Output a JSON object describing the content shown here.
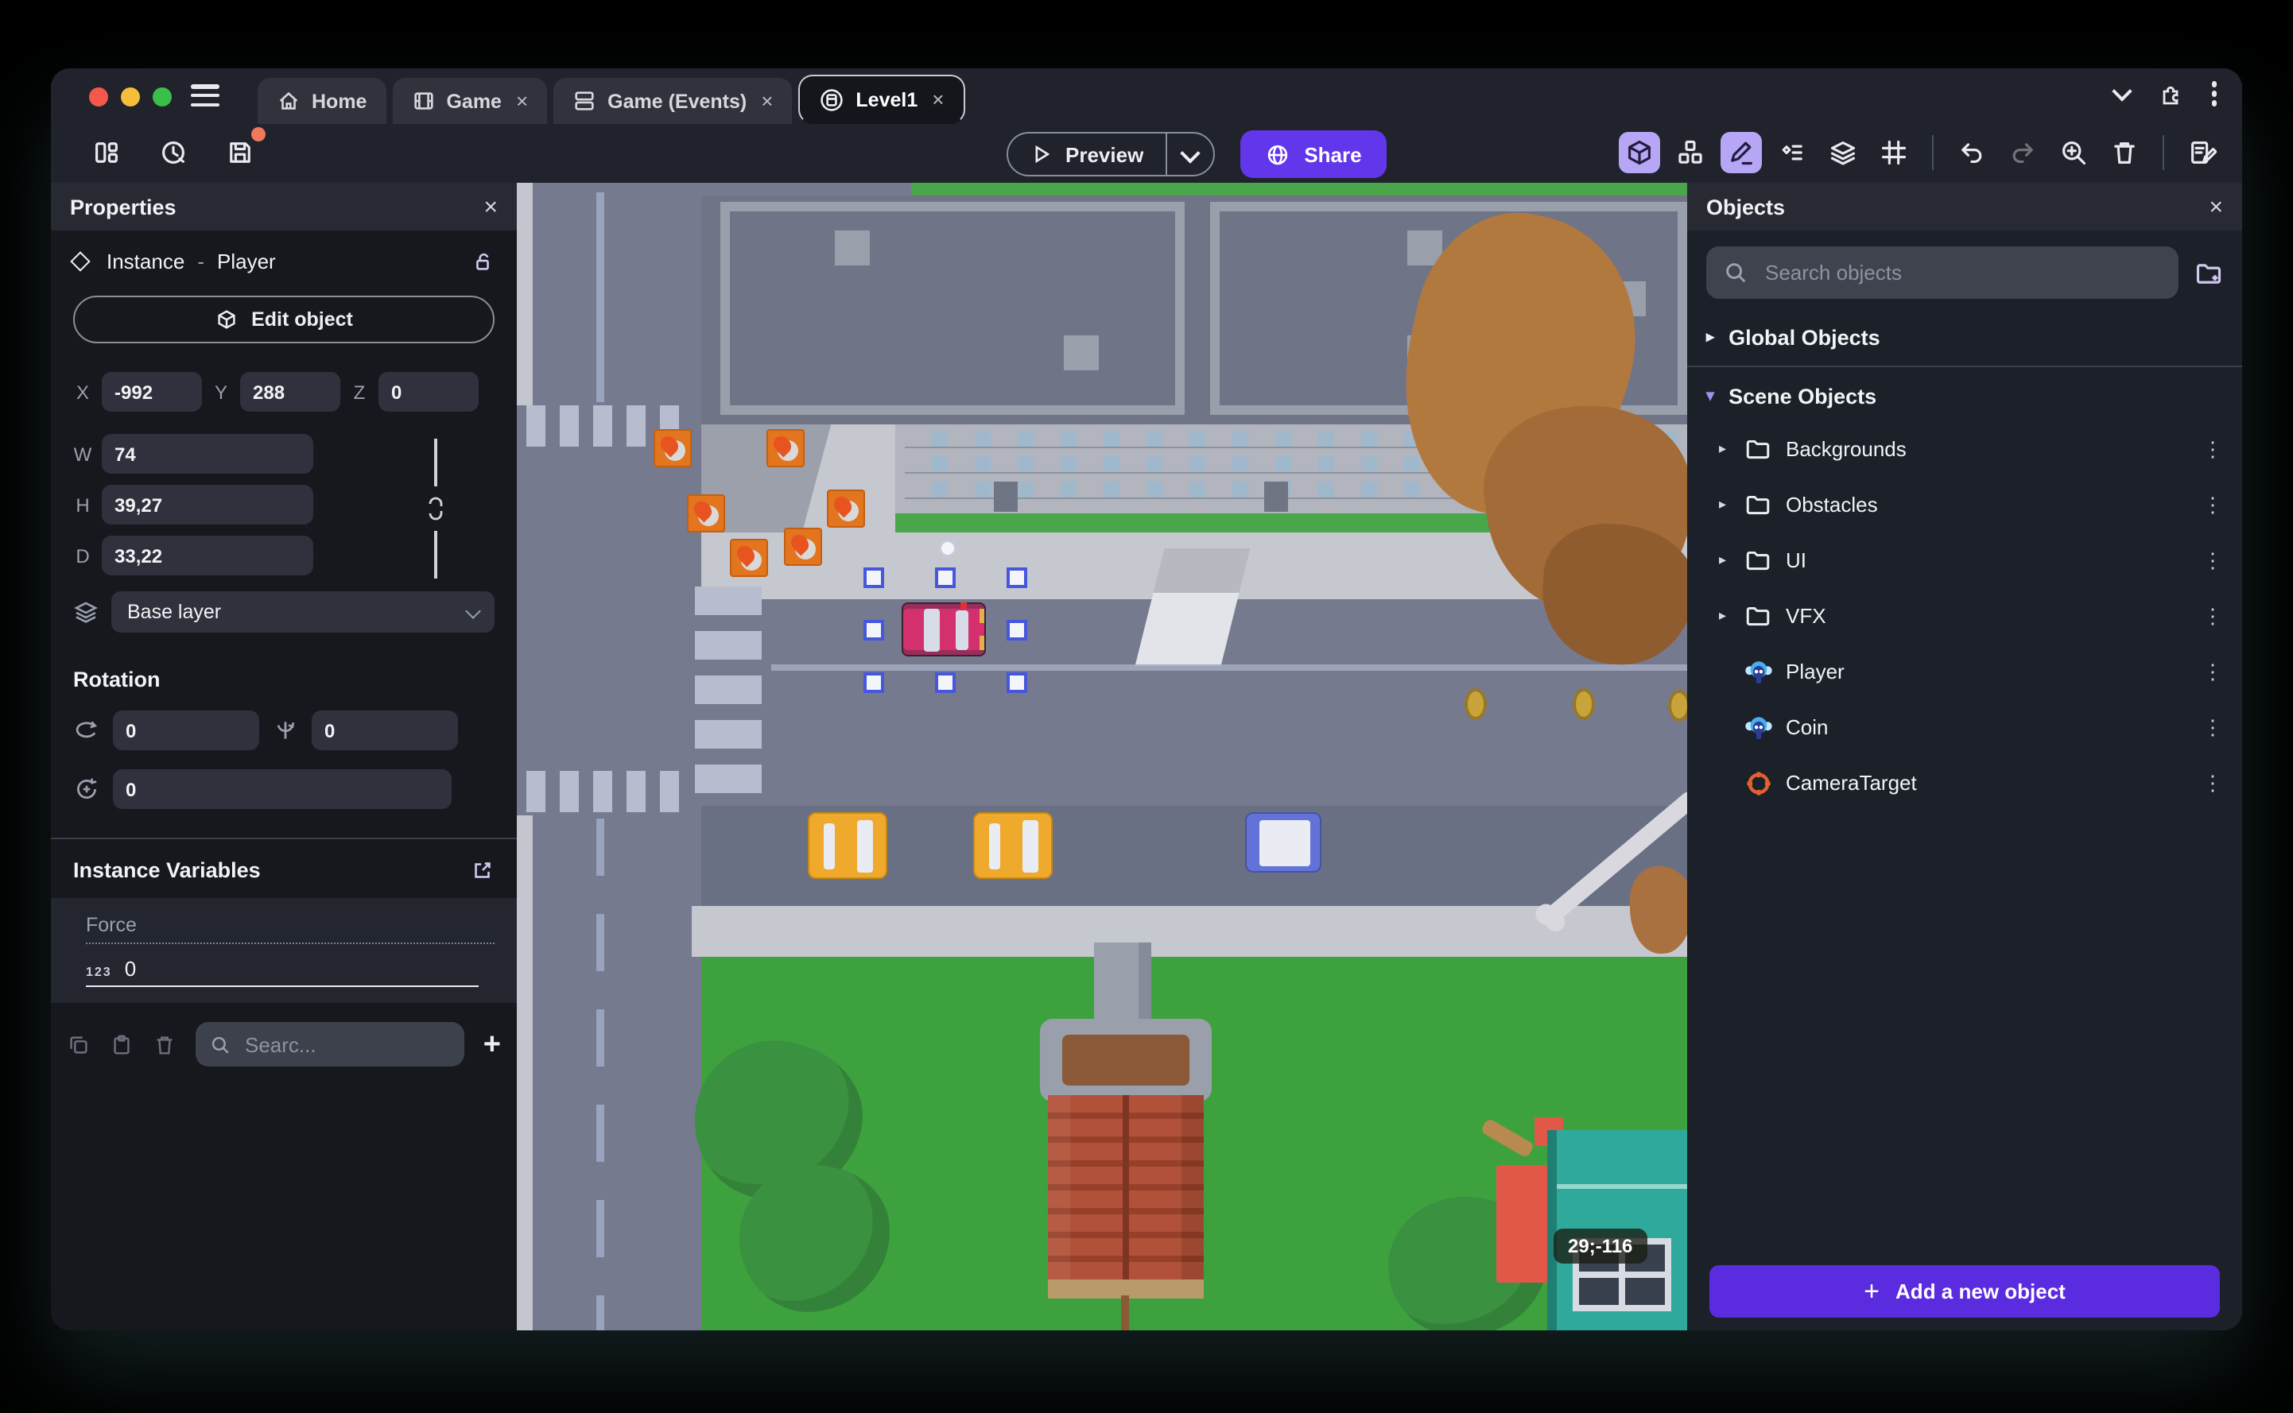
{
  "titlebar": {
    "tabs": [
      {
        "label": "Home"
      },
      {
        "label": "Game"
      },
      {
        "label": "Game (Events)"
      },
      {
        "label": "Level1"
      }
    ],
    "close_glyph": "×"
  },
  "toolbar": {
    "preview": "Preview",
    "share": "Share"
  },
  "properties": {
    "title": "Properties",
    "close_glyph": "×",
    "kind": "Instance",
    "dash": "-",
    "object_name": "Player",
    "edit_object": "Edit object",
    "x_label": "X",
    "x_value": "-992",
    "y_label": "Y",
    "y_value": "288",
    "z_label": "Z",
    "z_value": "0",
    "w_label": "W",
    "w_value": "74",
    "h_label": "H",
    "h_value": "39,27",
    "d_label": "D",
    "d_value": "33,22",
    "layer_value": "Base layer",
    "rotation_title": "Rotation",
    "rot_x": "0",
    "rot_y": "0",
    "rot_z": "0",
    "variables_title": "Instance Variables",
    "variable_name": "Force",
    "variable_type_badge": "123",
    "variable_value": "0",
    "variables_search_placeholder": "Searc...",
    "add_glyph": "+"
  },
  "objects": {
    "title": "Objects",
    "close_glyph": "×",
    "search_placeholder": "Search objects",
    "global_group": "Global Objects",
    "scene_group": "Scene Objects",
    "collapsed_glyph": "▸",
    "expanded_glyph": "▾",
    "menu_glyph": "⋮",
    "folders": [
      {
        "name": "Backgrounds"
      },
      {
        "name": "Obstacles"
      },
      {
        "name": "UI"
      },
      {
        "name": "VFX"
      }
    ],
    "items": [
      {
        "name": "Player",
        "icon": "monkey-icon"
      },
      {
        "name": "Coin",
        "icon": "monkey-icon"
      },
      {
        "name": "CameraTarget",
        "icon": "target-icon"
      }
    ],
    "add_button": "Add a new object",
    "add_glyph": "+"
  },
  "scene": {
    "badge": "29;-116"
  },
  "colors": {
    "accent": "#6236ea",
    "add_button": "#5b2be0",
    "toolbar_active_bg": "#b7a6f6",
    "selection": "#4656dd",
    "save_dot": "#f0795a",
    "traffic_red": "#f5574d",
    "traffic_yellow": "#f6bd3b",
    "traffic_green": "#3ac04a"
  }
}
